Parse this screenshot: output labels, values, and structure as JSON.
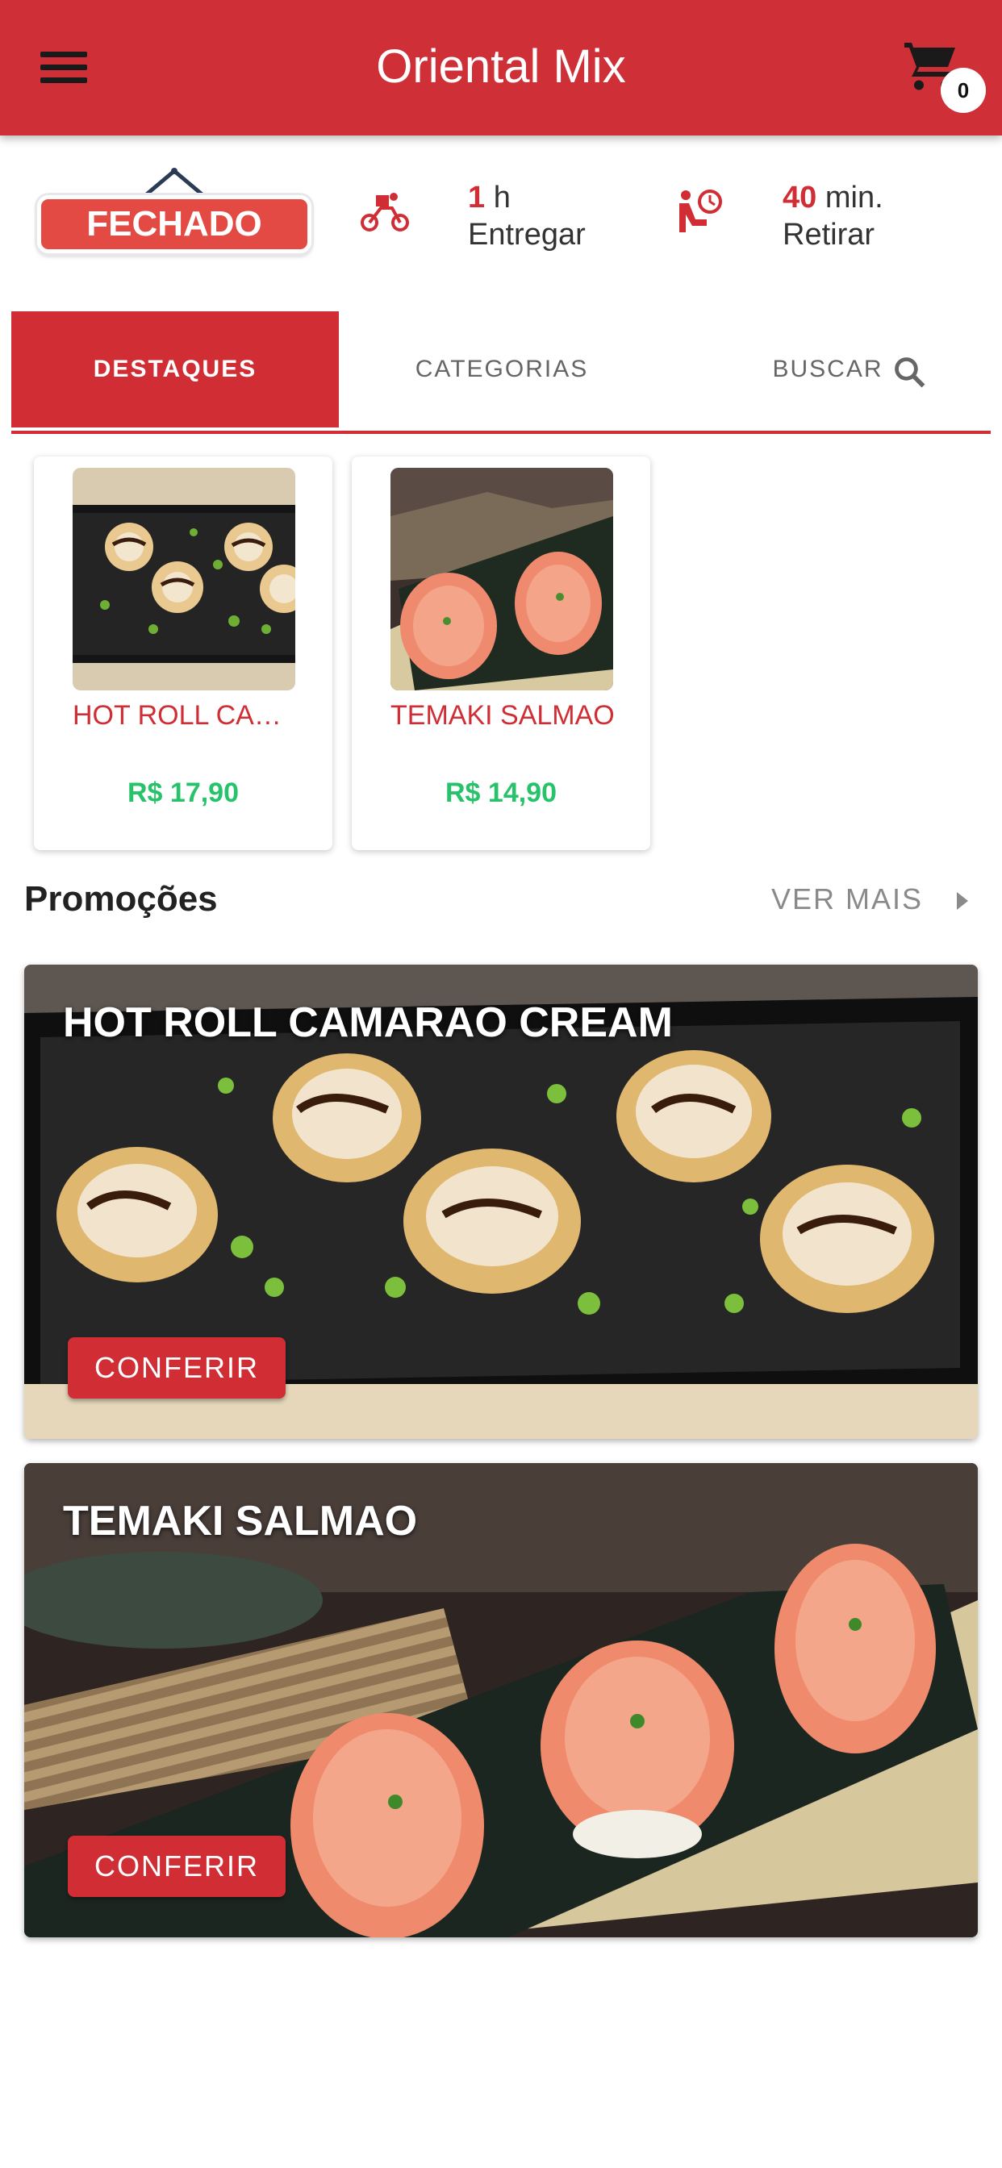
{
  "app": {
    "title": "Oriental Mix"
  },
  "cart": {
    "count": "0"
  },
  "store_status": {
    "sign": "FECHADO"
  },
  "delivery": {
    "value": "1",
    "unit": "h",
    "label": "Entregar"
  },
  "pickup": {
    "value": "40",
    "unit": "min.",
    "label": "Retirar"
  },
  "tabs": [
    {
      "label": "DESTAQUES"
    },
    {
      "label": "CATEGORIAS"
    },
    {
      "label": "BUSCAR"
    }
  ],
  "products": [
    {
      "name": "HOT ROLL CAMARAO CREAM",
      "price": "R$ 17,90"
    },
    {
      "name": "TEMAKI SALMAO",
      "price": "R$ 14,90"
    }
  ],
  "promotions": {
    "title": "Promoções",
    "see_more": "VER MAIS",
    "items": [
      {
        "title": "HOT ROLL CAMARAO CREAM",
        "button": "CONFERIR"
      },
      {
        "title": "TEMAKI SALMAO",
        "button": "CONFERIR"
      }
    ]
  },
  "colors": {
    "primary": "#d12d34",
    "price": "#27c36a",
    "closed_sign": "#e24a43"
  },
  "icons": [
    "menu-icon",
    "cart-icon",
    "delivery-bike-icon",
    "pickup-clock-icon",
    "search-icon",
    "chevron-right-icon"
  ]
}
